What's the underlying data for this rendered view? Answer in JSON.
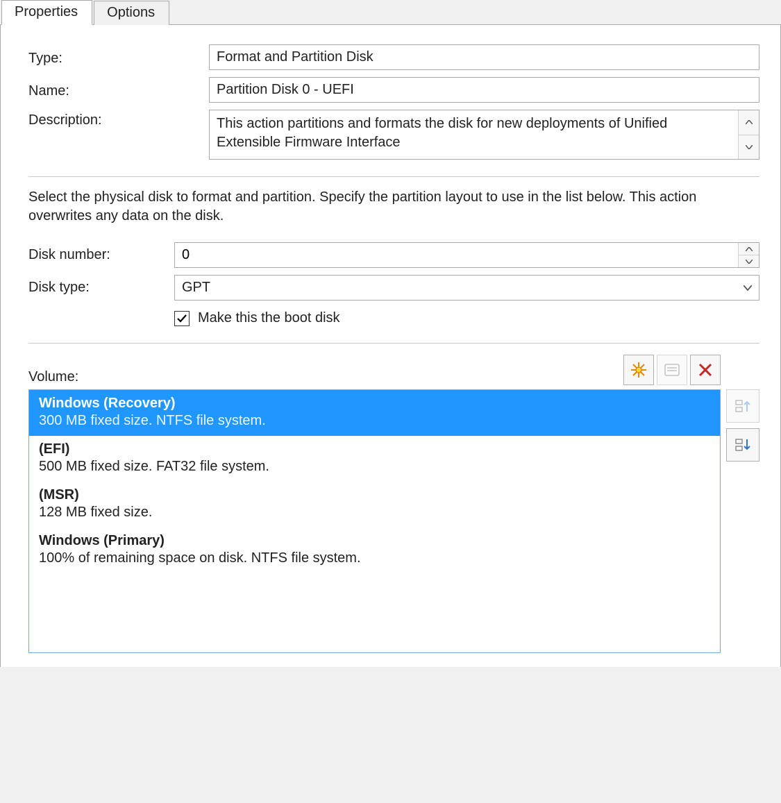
{
  "tabs": {
    "properties": "Properties",
    "options": "Options",
    "active": "properties"
  },
  "labels": {
    "type": "Type:",
    "name": "Name:",
    "description": "Description:",
    "disk_number": "Disk number:",
    "disk_type": "Disk type:",
    "volume": "Volume:",
    "boot_disk": "Make this the boot disk"
  },
  "fields": {
    "type_value": "Format and Partition Disk",
    "name_value": "Partition Disk 0 - UEFI",
    "description_value": "This action partitions and formats the disk for new deployments of Unified Extensible Firmware Interface",
    "disk_number_value": "0",
    "disk_type_value": "GPT",
    "boot_disk_checked": true
  },
  "instruction": "Select the physical disk to format and partition. Specify the partition layout to use in the list below. This action overwrites any data on the disk.",
  "toolbar": {
    "new": "new-partition-icon",
    "props": "partition-properties-icon",
    "delete": "delete-partition-icon",
    "moveup": "move-up-icon",
    "movedown": "move-down-icon"
  },
  "volumes": [
    {
      "title": "Windows (Recovery)",
      "sub": "300 MB fixed size. NTFS file system.",
      "selected": true
    },
    {
      "title": "(EFI)",
      "sub": "500 MB fixed size. FAT32 file system.",
      "selected": false
    },
    {
      "title": "(MSR)",
      "sub": "128 MB fixed size.",
      "selected": false
    },
    {
      "title": "Windows (Primary)",
      "sub": "100% of remaining space on disk. NTFS file system.",
      "selected": false
    }
  ]
}
